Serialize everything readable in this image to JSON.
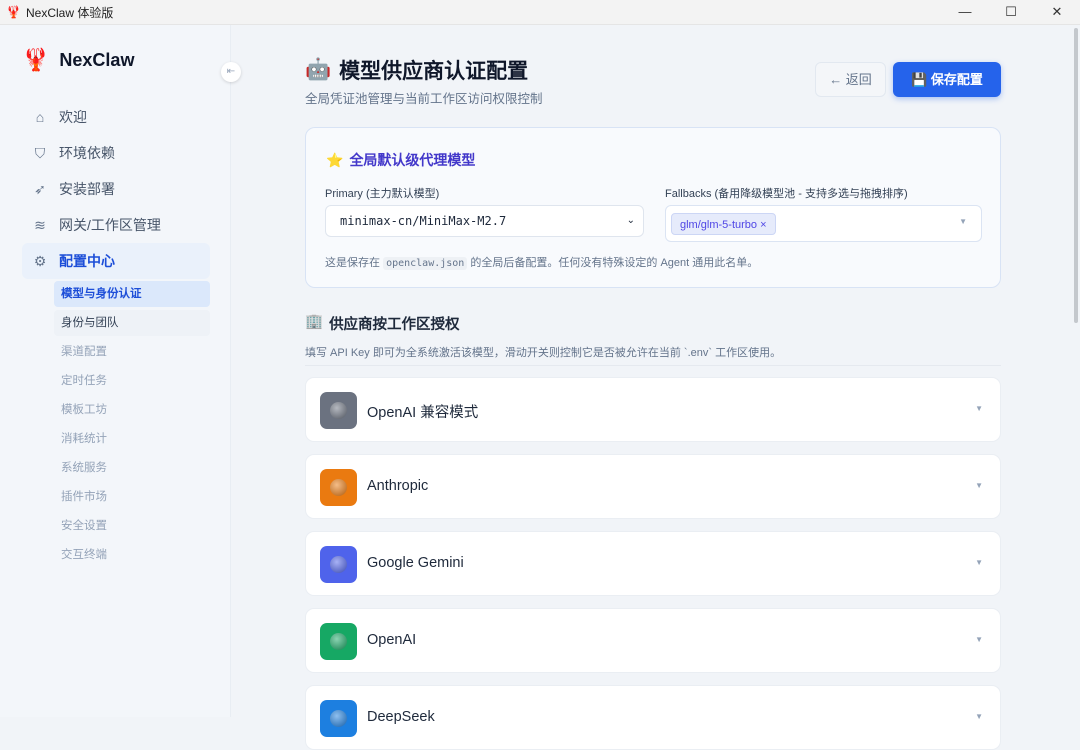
{
  "window": {
    "title": "NexClaw 体验版",
    "minimize": "—",
    "maximize": "☐",
    "close": "✕"
  },
  "sidebar": {
    "brand": "NexClaw",
    "items": [
      {
        "label": "欢迎",
        "icon": "home-icon",
        "glyph": "⌂"
      },
      {
        "label": "环境依赖",
        "icon": "shield-check-icon",
        "glyph": "⛉"
      },
      {
        "label": "安装部署",
        "icon": "rocket-icon",
        "glyph": "➶"
      },
      {
        "label": "网关/工作区管理",
        "icon": "layers-icon",
        "glyph": "≋"
      },
      {
        "label": "配置中心",
        "icon": "gear-icon",
        "glyph": "⚙"
      }
    ],
    "sub_items": [
      "模型与身份认证",
      "身份与团队",
      "渠道配置",
      "定时任务",
      "模板工坊",
      "消耗统计",
      "系统服务",
      "插件市场",
      "安全设置",
      "交互终端"
    ]
  },
  "header": {
    "icon": "🤖",
    "title": "模型供应商认证配置",
    "subtitle": "全局凭证池管理与当前工作区访问权限控制",
    "back": "← 返回",
    "save_icon": "💾",
    "save": "保存配置"
  },
  "defaults": {
    "icon": "⭐",
    "title": "全局默认级代理模型",
    "primary_label": "Primary (主力默认模型)",
    "primary_value": "minimax-cn/MiniMax-M2.7",
    "fallbacks_label": "Fallbacks (备用降级模型池 - 支持多选与拖拽排序)",
    "fallback_tag": "glm/glm-5-turbo ×",
    "note_pre": "这是保存在",
    "note_code": "openclaw.json",
    "note_post": "的全局后备配置。任何没有特殊设定的 Agent 通用此名单。"
  },
  "providers_section": {
    "icon": "🏢",
    "title": "供应商按工作区授权",
    "subtitle": "填写 API Key 即可为全系统激活该模型，滑动开关则控制它是否被允许在当前 `.env` 工作区使用。"
  },
  "providers": [
    {
      "name": "OpenAI 兼容模式",
      "color": "#6b7280"
    },
    {
      "name": "Anthropic",
      "color": "#ea7a10"
    },
    {
      "name": "Google Gemini",
      "color": "#4f63eb"
    },
    {
      "name": "OpenAI",
      "color": "#16a864"
    },
    {
      "name": "DeepSeek",
      "color": "#1d7fe0"
    }
  ]
}
